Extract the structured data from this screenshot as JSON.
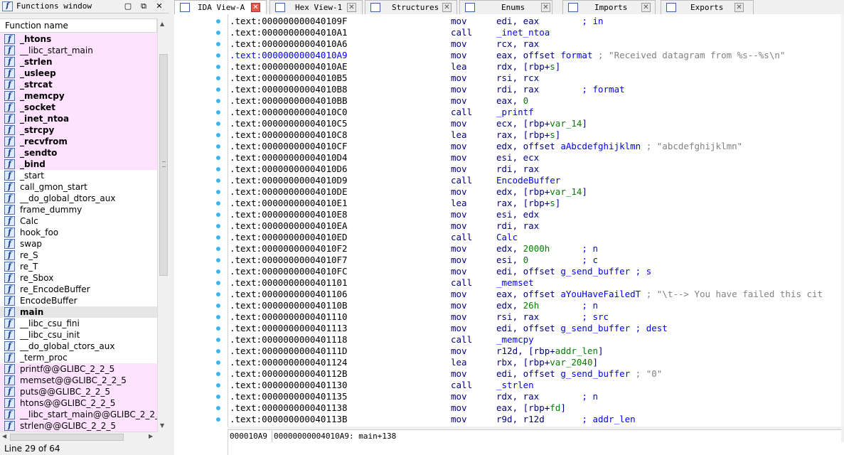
{
  "functions_window": {
    "title": "Functions window",
    "column_header": "Function name",
    "status": "Line 29 of 64",
    "items": [
      {
        "name": "_htons",
        "bold": true,
        "pink": true
      },
      {
        "name": "__libc_start_main",
        "bold": false,
        "pink": true
      },
      {
        "name": "_strlen",
        "bold": true,
        "pink": true
      },
      {
        "name": "_usleep",
        "bold": true,
        "pink": true
      },
      {
        "name": "_strcat",
        "bold": true,
        "pink": true
      },
      {
        "name": "_memcpy",
        "bold": true,
        "pink": true
      },
      {
        "name": "_socket",
        "bold": true,
        "pink": true
      },
      {
        "name": "_inet_ntoa",
        "bold": true,
        "pink": true
      },
      {
        "name": "_strcpy",
        "bold": true,
        "pink": true
      },
      {
        "name": "_recvfrom",
        "bold": true,
        "pink": true
      },
      {
        "name": "_sendto",
        "bold": true,
        "pink": true
      },
      {
        "name": "_bind",
        "bold": true,
        "pink": true
      },
      {
        "name": "_start",
        "bold": false,
        "pink": false
      },
      {
        "name": "call_gmon_start",
        "bold": false,
        "pink": false
      },
      {
        "name": "__do_global_dtors_aux",
        "bold": false,
        "pink": false
      },
      {
        "name": "frame_dummy",
        "bold": false,
        "pink": false
      },
      {
        "name": "Calc",
        "bold": false,
        "pink": false
      },
      {
        "name": "hook_foo",
        "bold": false,
        "pink": false
      },
      {
        "name": "swap",
        "bold": false,
        "pink": false
      },
      {
        "name": "re_S",
        "bold": false,
        "pink": false
      },
      {
        "name": "re_T",
        "bold": false,
        "pink": false
      },
      {
        "name": "re_Sbox",
        "bold": false,
        "pink": false
      },
      {
        "name": "re_EncodeBuffer",
        "bold": false,
        "pink": false
      },
      {
        "name": "EncodeBuffer",
        "bold": false,
        "pink": false
      },
      {
        "name": "main",
        "bold": true,
        "pink": false,
        "selected": true
      },
      {
        "name": "__libc_csu_fini",
        "bold": false,
        "pink": false
      },
      {
        "name": "__libc_csu_init",
        "bold": false,
        "pink": false
      },
      {
        "name": "__do_global_ctors_aux",
        "bold": false,
        "pink": false
      },
      {
        "name": "_term_proc",
        "bold": false,
        "pink": false
      },
      {
        "name": "printf@@GLIBC_2_2_5",
        "bold": false,
        "pink": true
      },
      {
        "name": "memset@@GLIBC_2_2_5",
        "bold": false,
        "pink": true
      },
      {
        "name": "puts@@GLIBC_2_2_5",
        "bold": false,
        "pink": true
      },
      {
        "name": "htons@@GLIBC_2_2_5",
        "bold": false,
        "pink": true
      },
      {
        "name": "__libc_start_main@@GLIBC_2_2_5",
        "bold": false,
        "pink": true
      },
      {
        "name": "strlen@@GLIBC_2_2_5",
        "bold": false,
        "pink": true
      }
    ]
  },
  "tabs": [
    {
      "label": "IDA View-A",
      "active": true,
      "icon": "ida-view-icon"
    },
    {
      "label": "Hex View-1",
      "active": false,
      "icon": "hex-view-icon"
    },
    {
      "label": "Structures",
      "active": false,
      "icon": "structures-icon"
    },
    {
      "label": "Enums",
      "active": false,
      "icon": "enums-icon"
    },
    {
      "label": "Imports",
      "active": false,
      "icon": "imports-icon"
    },
    {
      "label": "Exports",
      "active": false,
      "icon": "exports-icon"
    }
  ],
  "code_lines": [
    {
      "addr": ".text:000000000040109F",
      "mn": "mov",
      "ops": [
        [
          "edi, eax",
          ""
        ],
        [
          "        ; in",
          "cmt blue"
        ]
      ]
    },
    {
      "addr": ".text:00000000004010A1",
      "mn": "call",
      "ops": [
        [
          "_inet_ntoa",
          "ref"
        ]
      ]
    },
    {
      "addr": ".text:00000000004010A6",
      "mn": "mov",
      "ops": [
        [
          "rcx, rax",
          ""
        ]
      ]
    },
    {
      "addr": ".text:00000000004010A9",
      "hl": true,
      "mn": "mov",
      "ops": [
        [
          "eax, offset ",
          ""
        ],
        [
          "format",
          "ref"
        ],
        [
          " ; \"Received datagram from %s--%s\\n\"",
          "cmt"
        ]
      ]
    },
    {
      "addr": ".text:00000000004010AE",
      "mn": "lea",
      "ops": [
        [
          "rdx, [rbp+",
          ""
        ],
        [
          "s",
          "var"
        ],
        [
          "]",
          ""
        ]
      ]
    },
    {
      "addr": ".text:00000000004010B5",
      "mn": "mov",
      "ops": [
        [
          "rsi, rcx",
          ""
        ]
      ]
    },
    {
      "addr": ".text:00000000004010B8",
      "mn": "mov",
      "ops": [
        [
          "rdi, rax",
          ""
        ],
        [
          "        ; format",
          "cmt blue"
        ]
      ]
    },
    {
      "addr": ".text:00000000004010BB",
      "mn": "mov",
      "ops": [
        [
          "eax, ",
          ""
        ],
        [
          "0",
          "num"
        ]
      ]
    },
    {
      "addr": ".text:00000000004010C0",
      "mn": "call",
      "ops": [
        [
          "_printf",
          "ref"
        ]
      ]
    },
    {
      "addr": ".text:00000000004010C5",
      "mn": "mov",
      "ops": [
        [
          "ecx, [rbp+",
          ""
        ],
        [
          "var_14",
          "var"
        ],
        [
          "]",
          ""
        ]
      ]
    },
    {
      "addr": ".text:00000000004010C8",
      "mn": "lea",
      "ops": [
        [
          "rax, [rbp+",
          ""
        ],
        [
          "s",
          "var"
        ],
        [
          "]",
          ""
        ]
      ]
    },
    {
      "addr": ".text:00000000004010CF",
      "mn": "mov",
      "ops": [
        [
          "edx, offset ",
          ""
        ],
        [
          "aAbcdefghijklmn",
          "ref"
        ],
        [
          " ; \"abcdefghijklmn\"",
          "cmt"
        ]
      ]
    },
    {
      "addr": ".text:00000000004010D4",
      "mn": "mov",
      "ops": [
        [
          "esi, ecx",
          ""
        ]
      ]
    },
    {
      "addr": ".text:00000000004010D6",
      "mn": "mov",
      "ops": [
        [
          "rdi, rax",
          ""
        ]
      ]
    },
    {
      "addr": ".text:00000000004010D9",
      "mn": "call",
      "ops": [
        [
          "EncodeBuffer",
          "ref"
        ]
      ]
    },
    {
      "addr": ".text:00000000004010DE",
      "mn": "mov",
      "ops": [
        [
          "edx, [rbp+",
          ""
        ],
        [
          "var_14",
          "var"
        ],
        [
          "]",
          ""
        ]
      ]
    },
    {
      "addr": ".text:00000000004010E1",
      "mn": "lea",
      "ops": [
        [
          "rax, [rbp+",
          ""
        ],
        [
          "s",
          "var"
        ],
        [
          "]",
          ""
        ]
      ]
    },
    {
      "addr": ".text:00000000004010E8",
      "mn": "mov",
      "ops": [
        [
          "esi, edx",
          ""
        ]
      ]
    },
    {
      "addr": ".text:00000000004010EA",
      "mn": "mov",
      "ops": [
        [
          "rdi, rax",
          ""
        ]
      ]
    },
    {
      "addr": ".text:00000000004010ED",
      "mn": "call",
      "ops": [
        [
          "Calc",
          "ref"
        ]
      ]
    },
    {
      "addr": ".text:00000000004010F2",
      "mn": "mov",
      "ops": [
        [
          "edx, ",
          ""
        ],
        [
          "2000h",
          "num"
        ],
        [
          "      ; n",
          "cmt blue"
        ]
      ]
    },
    {
      "addr": ".text:00000000004010F7",
      "mn": "mov",
      "ops": [
        [
          "esi, ",
          ""
        ],
        [
          "0",
          "num"
        ],
        [
          "          ; c",
          "cmt blue"
        ]
      ]
    },
    {
      "addr": ".text:00000000004010FC",
      "mn": "mov",
      "ops": [
        [
          "edi, offset ",
          ""
        ],
        [
          "g_send_buffer",
          "ref"
        ],
        [
          " ; s",
          "cmt blue"
        ]
      ]
    },
    {
      "addr": ".text:0000000000401101",
      "mn": "call",
      "ops": [
        [
          "_memset",
          "ref"
        ]
      ]
    },
    {
      "addr": ".text:0000000000401106",
      "mn": "mov",
      "ops": [
        [
          "eax, offset ",
          ""
        ],
        [
          "aYouHaveFailedT",
          "ref"
        ],
        [
          " ; \"\\t--> You have failed this cit",
          "cmt"
        ]
      ]
    },
    {
      "addr": ".text:000000000040110B",
      "mn": "mov",
      "ops": [
        [
          "edx, ",
          ""
        ],
        [
          "26h",
          "num"
        ],
        [
          "        ; n",
          "cmt blue"
        ]
      ]
    },
    {
      "addr": ".text:0000000000401110",
      "mn": "mov",
      "ops": [
        [
          "rsi, rax",
          ""
        ],
        [
          "        ; src",
          "cmt blue"
        ]
      ]
    },
    {
      "addr": ".text:0000000000401113",
      "mn": "mov",
      "ops": [
        [
          "edi, offset ",
          ""
        ],
        [
          "g_send_buffer",
          "ref"
        ],
        [
          " ; dest",
          "cmt blue"
        ]
      ]
    },
    {
      "addr": ".text:0000000000401118",
      "mn": "call",
      "ops": [
        [
          "_memcpy",
          "ref"
        ]
      ]
    },
    {
      "addr": ".text:000000000040111D",
      "mn": "mov",
      "ops": [
        [
          "r12d, [rbp+",
          ""
        ],
        [
          "addr_len",
          "var"
        ],
        [
          "]",
          ""
        ]
      ]
    },
    {
      "addr": ".text:0000000000401124",
      "mn": "lea",
      "ops": [
        [
          "rbx, [rbp+",
          ""
        ],
        [
          "var_2040",
          "var"
        ],
        [
          "]",
          ""
        ]
      ]
    },
    {
      "addr": ".text:000000000040112B",
      "mn": "mov",
      "ops": [
        [
          "edi, offset ",
          ""
        ],
        [
          "g_send_buffer",
          "ref"
        ],
        [
          " ; \"0\"",
          "cmt"
        ]
      ]
    },
    {
      "addr": ".text:0000000000401130",
      "mn": "call",
      "ops": [
        [
          "_strlen",
          "ref"
        ]
      ]
    },
    {
      "addr": ".text:0000000000401135",
      "mn": "mov",
      "ops": [
        [
          "rdx, rax",
          ""
        ],
        [
          "        ; n",
          "cmt blue"
        ]
      ]
    },
    {
      "addr": ".text:0000000000401138",
      "mn": "mov",
      "ops": [
        [
          "eax, [rbp+",
          ""
        ],
        [
          "fd",
          "var"
        ],
        [
          "]",
          ""
        ]
      ]
    },
    {
      "addr": ".text:000000000040113B",
      "mn": "mov",
      "ops": [
        [
          "r9d, r12d",
          ""
        ],
        [
          "       ; addr_len",
          "cmt blue"
        ]
      ]
    }
  ],
  "code_status": {
    "offset": "000010A9",
    "location": "00000000004010A9: main+138"
  }
}
